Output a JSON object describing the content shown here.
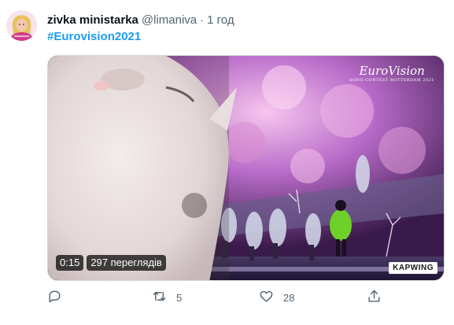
{
  "tweet": {
    "display_name": "zivka ministarka",
    "handle": "@limaniva",
    "separator": "·",
    "time": "1 год",
    "hashtag": "#Eurovision2021"
  },
  "media": {
    "duration": "0:15",
    "views": "297 переглядів",
    "watermark": "KAPWING",
    "logo_main": "EuroVision",
    "logo_sub": "SONG CONTEST ROTTERDAM 2021"
  },
  "actions": {
    "reply_icon": "reply-icon",
    "retweet_icon": "retweet-icon",
    "retweet_count": "5",
    "like_icon": "like-icon",
    "like_count": "28",
    "share_icon": "share-icon"
  },
  "colors": {
    "link": "#1d9bf0",
    "secondary_text": "#536471",
    "primary_text": "#0f1419"
  }
}
